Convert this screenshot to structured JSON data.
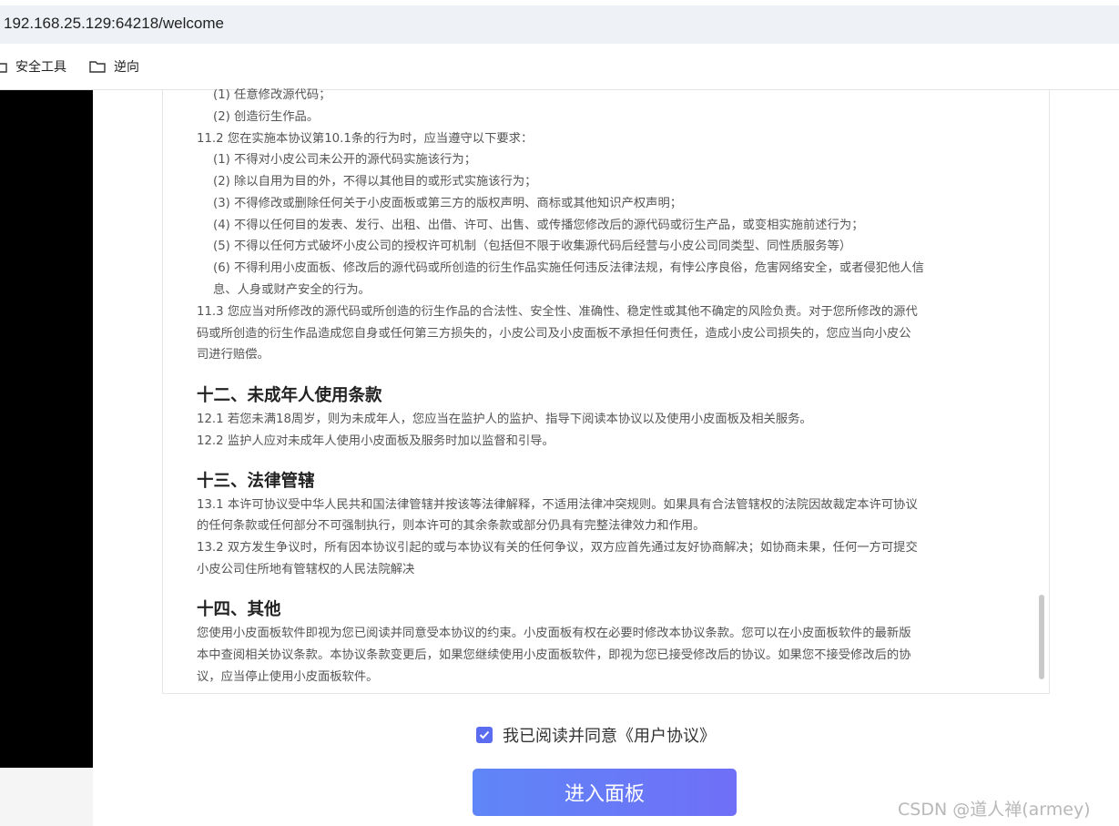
{
  "browser": {
    "url": "192.168.25.129:64218/welcome",
    "bookmarks": [
      "安全工具",
      "逆向"
    ]
  },
  "agreement": {
    "lines": [
      "(1) 任意修改源代码；",
      "(2) 创造衍生作品。",
      "11.2 您在实施本协议第10.1条的行为时，应当遵守以下要求：",
      "(1) 不得对小皮公司未公开的源代码实施该行为；",
      "(2) 除以自用为目的外，不得以其他目的或形式实施该行为；",
      "(3) 不得修改或删除任何关于小皮面板或第三方的版权声明、商标或其他知识产权声明；",
      "(4) 不得以任何目的发表、发行、出租、出借、许可、出售、或传播您修改后的源代码或衍生产品，或变相实施前述行为；",
      "(5) 不得以任何方式破坏小皮公司的授权许可机制（包括但不限于收集源代码后经营与小皮公司同类型、同性质服务等）",
      "(6) 不得利用小皮面板、修改后的源代码或所创造的衍生作品实施任何违反法律法规，有悖公序良俗，危害网络安全，或者侵犯他人信",
      "息、人身或财产安全的行为。",
      "11.3 您应当对所修改的源代码或所创造的衍生作品的合法性、安全性、准确性、稳定性或其他不确定的风险负责。对于您所修改的源代",
      "码或所创造的衍生作品造成您自身或任何第三方损失的，小皮公司及小皮面板不承担任何责任，造成小皮公司损失的，您应当向小皮公",
      "司进行赔偿。",
      "12.1 若您未满18周岁，则为未成年人，您应当在监护人的监护、指导下阅读本协议以及使用小皮面板及相关服务。",
      "12.2 监护人应对未成年人使用小皮面板及服务时加以监督和引导。",
      "13.1 本许可协议受中华人民共和国法律管辖并按该等法律解释，不适用法律冲突规则。如果具有合法管辖权的法院因故裁定本许可协议",
      "的任何条款或任何部分不可强制执行，则本许可的其余条款或部分仍具有完整法律效力和作用。",
      "13.2 双方发生争议时，所有因本协议引起的或与本协议有关的任何争议，双方应首先通过友好协商解决；如协商未果，任何一方可提交",
      "小皮公司住所地有管辖权的人民法院解决",
      "您使用小皮面板软件即视为您已阅读并同意受本协议的约束。小皮面板有权在必要时修改本协议条款。您可以在小皮面板软件的最新版",
      "本中查阅相关协议条款。本协议条款变更后，如果您继续使用小皮面板软件，即视为您已接受修改后的协议。如果您不接受修改后的协",
      "议，应当停止使用小皮面板软件。"
    ],
    "headings": [
      "十二、未成年人使用条款",
      "十三、法律管辖",
      "十四、其他"
    ]
  },
  "agree_checkbox": {
    "checked": true,
    "label": "我已阅读并同意《用户协议》"
  },
  "enter_button": {
    "label": "进入面板"
  },
  "watermark": "CSDN @道人禅(armey)",
  "colors": {
    "accent": "#5b6cf0",
    "button_start": "#5f86f7",
    "button_end": "#6f6ff7"
  }
}
